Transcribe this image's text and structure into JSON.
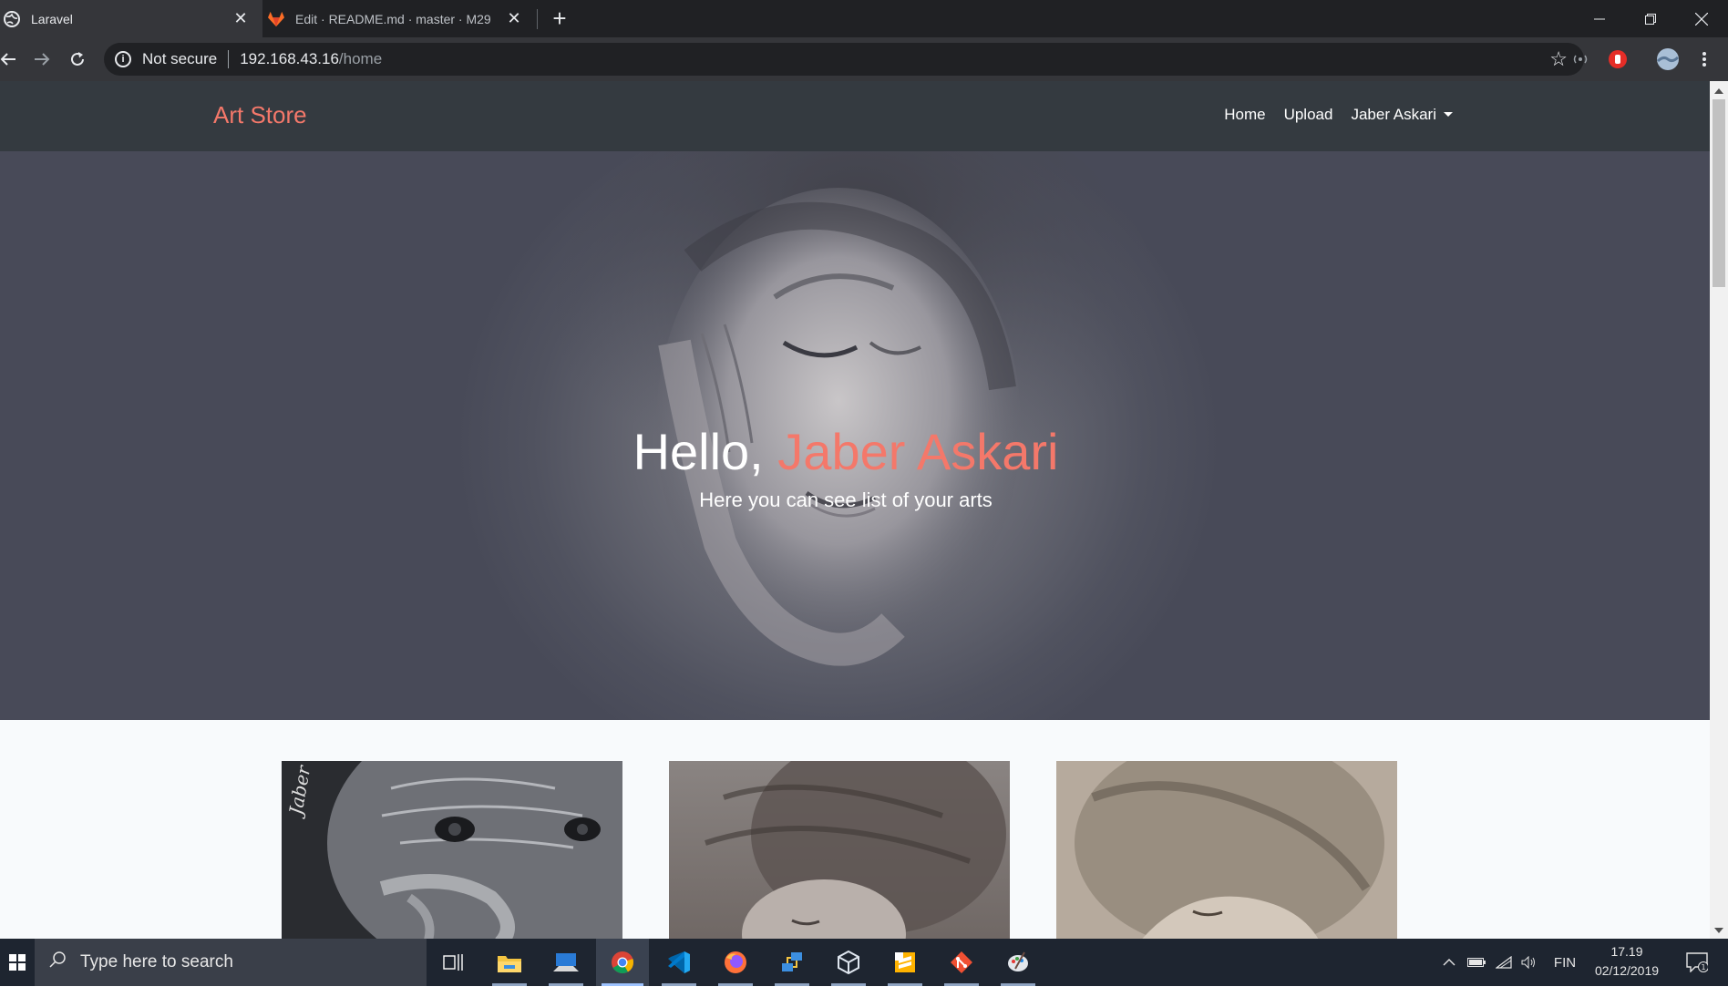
{
  "browser": {
    "tabs": [
      {
        "title": "Laravel",
        "active": true
      },
      {
        "title": "Edit · README.md · master · M29",
        "active": false
      }
    ],
    "close_glyph": "✕",
    "new_tab_glyph": "+",
    "security_label": "Not secure",
    "url_host": "192.168.43.16",
    "url_path": "/home",
    "window_controls": [
      "minimize-icon",
      "restore-icon",
      "close-icon"
    ]
  },
  "site": {
    "brand": "Art Store",
    "brand_color": "#f4786a",
    "nav": {
      "home": "Home",
      "upload": "Upload",
      "user": "Jaber Askari"
    },
    "hero": {
      "greeting": "Hello, ",
      "name": "Jaber Askari",
      "subtitle": "Here you can see list of your arts"
    },
    "cards": [
      {
        "alt": "portrait drawing of old man",
        "signature": "Jaber"
      },
      {
        "alt": "drawing of woman with flowing hair"
      },
      {
        "alt": "sepia drawing of woman's face"
      }
    ]
  },
  "taskbar": {
    "search_placeholder": "Type here to search",
    "lang": "FIN",
    "time": "17.19",
    "date": "02/12/2019",
    "notification_count": "1",
    "apps": [
      "task-view-icon",
      "file-explorer-icon",
      "remote-desktop-icon",
      "chrome-icon",
      "vscode-icon",
      "firefox-icon",
      "network-app-icon",
      "virtualbox-icon",
      "sublime-icon",
      "git-icon",
      "paint-icon"
    ]
  }
}
